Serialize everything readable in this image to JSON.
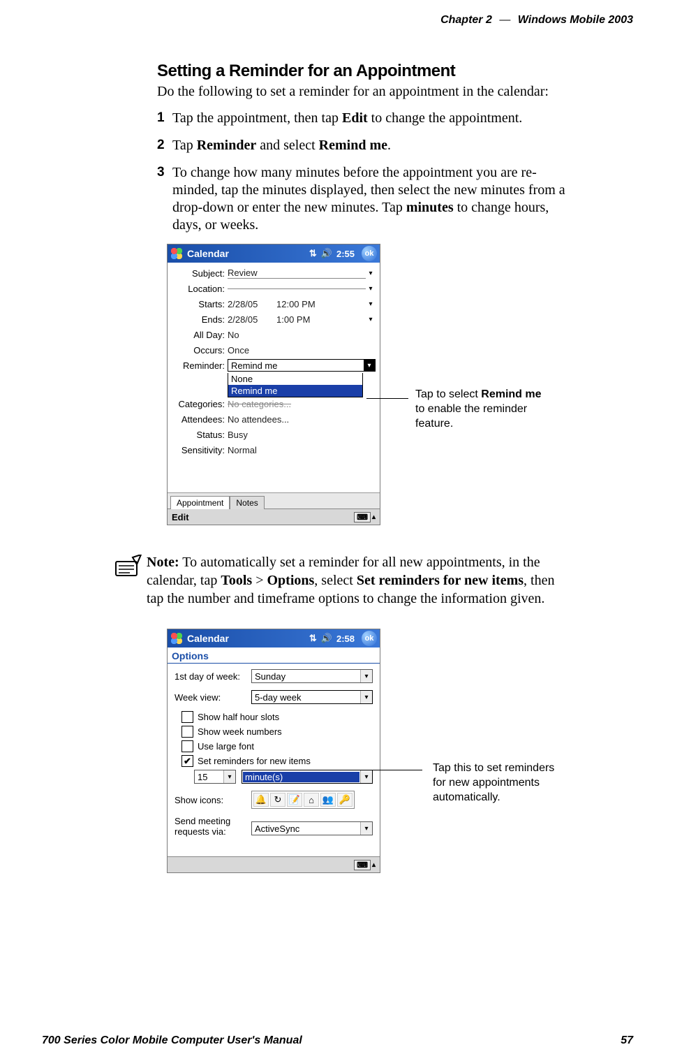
{
  "header": {
    "chapter": "Chapter  2",
    "dash": "—",
    "product": "Windows Mobile 2003"
  },
  "section": {
    "heading": "Setting a Reminder for an Appointment",
    "intro": "Do the following to set a reminder for an appointment in the calendar:",
    "steps": {
      "n1": "1",
      "s1": {
        "pre": "Tap the appointment, then tap ",
        "b1": "Edit",
        "post": " to change the appointment."
      },
      "n2": "2",
      "s2": {
        "pre": "Tap ",
        "b1": "Reminder",
        "mid": " and select ",
        "b2": "Remind me",
        "post": "."
      },
      "n3": "3",
      "s3": {
        "l1": "To change how many minutes before the appointment you are re-",
        "l2": "minded, tap the minutes displayed, then select the new minutes from a ",
        "l3a": "drop-down or enter the new minutes. Tap ",
        "l3b": "minutes",
        "l3c": " to change hours, ",
        "l4": "days, or weeks."
      }
    }
  },
  "fig1": {
    "titlebar": {
      "title": "Calendar",
      "time": "2:55",
      "ok": "ok"
    },
    "rows": {
      "subject_lbl": "Subject:",
      "subject": "Review",
      "location_lbl": "Location:",
      "location": "",
      "starts_lbl": "Starts:",
      "starts_date": "2/28/05",
      "starts_time": "12:00 PM",
      "ends_lbl": "Ends:",
      "ends_date": "2/28/05",
      "ends_time": "1:00 PM",
      "allday_lbl": "All Day:",
      "allday": "No",
      "occurs_lbl": "Occurs:",
      "occurs": "Once",
      "reminder_lbl": "Reminder:",
      "reminder_sel": "Remind me",
      "dd_none": "None",
      "dd_remind": "Remind me",
      "categories_lbl": "Categories:",
      "categories": "No categories...",
      "attendees_lbl": "Attendees:",
      "attendees": "No attendees...",
      "status_lbl": "Status:",
      "status": "Busy",
      "sensitivity_lbl": "Sensitivity:",
      "sensitivity": "Normal"
    },
    "tabs": {
      "appt": "Appointment",
      "notes": "Notes"
    },
    "footer": {
      "edit": "Edit"
    },
    "callout": {
      "t1": "Tap to select ",
      "t1b": "Remind me",
      "t2": "to enable the reminder",
      "t3": "feature."
    }
  },
  "note": {
    "label": "Note:",
    "t1": " To automatically set a reminder for all new appointments, in the ",
    "t2a": "calendar, tap ",
    "t2b1": "Tools",
    "t2gt": " > ",
    "t2b2": "Options",
    "t2c": ", select ",
    "t2b3": "Set reminders for new items",
    "t2d": ", then ",
    "t3": "tap the number and timeframe options to change the information given."
  },
  "fig2": {
    "titlebar": {
      "title": "Calendar",
      "time": "2:58",
      "ok": "ok"
    },
    "options_heading": "Options",
    "rows": {
      "firstday_lbl": "1st day of week:",
      "firstday": "Sunday",
      "weekview_lbl": "Week view:",
      "weekview": "5-day week",
      "chk1": "Show half hour slots",
      "chk2": "Show week numbers",
      "chk3": "Use large font",
      "chk4": "Set reminders for new items",
      "num": "15",
      "unit": "minute(s)",
      "showicons_lbl": "Show icons:",
      "send_lbl": "Send meeting",
      "send_lbl2": "requests via:",
      "send_val": "ActiveSync"
    },
    "callout": {
      "t1": "Tap this to set reminders",
      "t2": "for new appointments",
      "t3": "automatically."
    }
  },
  "footer": {
    "left": "700 Series Color Mobile Computer User's Manual",
    "right": "57"
  }
}
